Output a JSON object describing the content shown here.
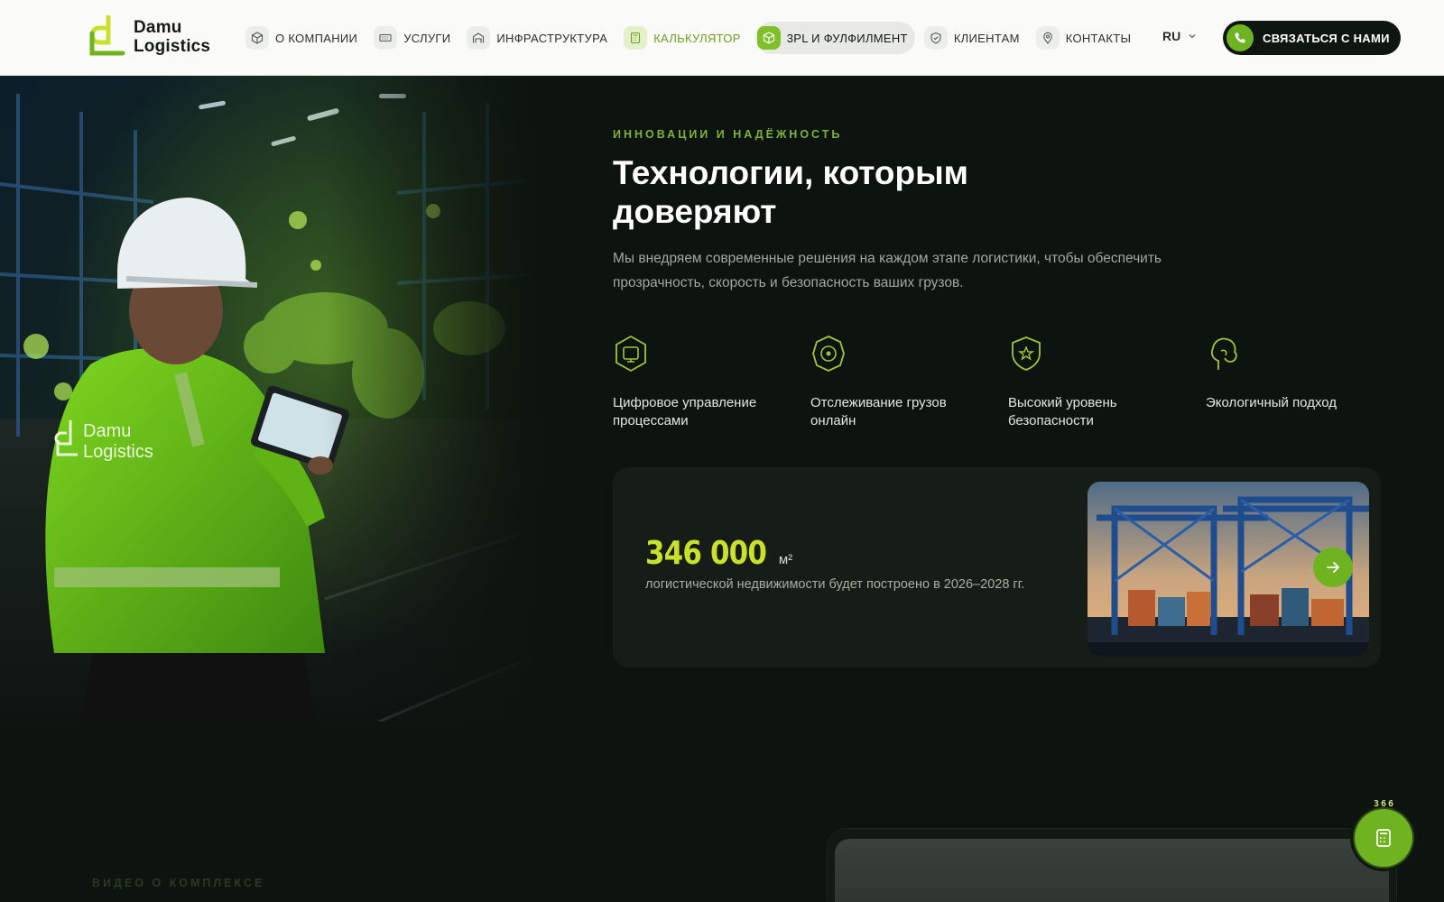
{
  "header": {
    "logo": {
      "line1": "Damu",
      "line2": "Logistics"
    },
    "nav": [
      {
        "label": "О КОМПАНИИ",
        "icon": "cube-icon"
      },
      {
        "label": "УСЛУГИ",
        "icon": "keyboard-icon"
      },
      {
        "label": "ИНФРАСТРУКТУРА",
        "icon": "warehouse-icon"
      },
      {
        "label": "КАЛЬКУЛЯТОР",
        "icon": "calculator-icon"
      },
      {
        "label": "3PL И ФУЛФИЛМЕНТ",
        "icon": "box-icon"
      },
      {
        "label": "КЛИЕНТАМ",
        "icon": "shield-icon"
      },
      {
        "label": "КОНТАКТЫ",
        "icon": "location-pin-icon"
      }
    ],
    "language": "RU",
    "contact_button": "СВЯЗАТЬСЯ С НАМИ"
  },
  "hero": {
    "eyebrow": "ИННОВАЦИИ И НАДЁЖНОСТЬ",
    "title": "Технологии, которым доверяют",
    "description": "Мы внедряем современные решения на каждом этапе логистики, чтобы обеспечить прозрачность, скорость и безопасность ваших грузов.",
    "features": [
      {
        "label": "Цифровое управление процессами",
        "icon": "digital-management-icon"
      },
      {
        "label": "Отслеживание грузов онлайн",
        "icon": "tracking-icon"
      },
      {
        "label": "Высокий уровень безопасности",
        "icon": "security-shield-icon"
      },
      {
        "label": "Экологичный подход",
        "icon": "eco-icon"
      }
    ],
    "stat": {
      "value": "346 000",
      "unit": "м²",
      "text": "логистической недвижимости будет построено в 2026–2028 гг."
    }
  },
  "video_section": {
    "eyebrow": "ВИДЕО О КОМПЛЕКСЕ"
  },
  "floating_calc": {
    "count": "366"
  },
  "colors": {
    "accent": "#6fb321",
    "highlight": "#c9e02c",
    "background": "#0d130e"
  }
}
